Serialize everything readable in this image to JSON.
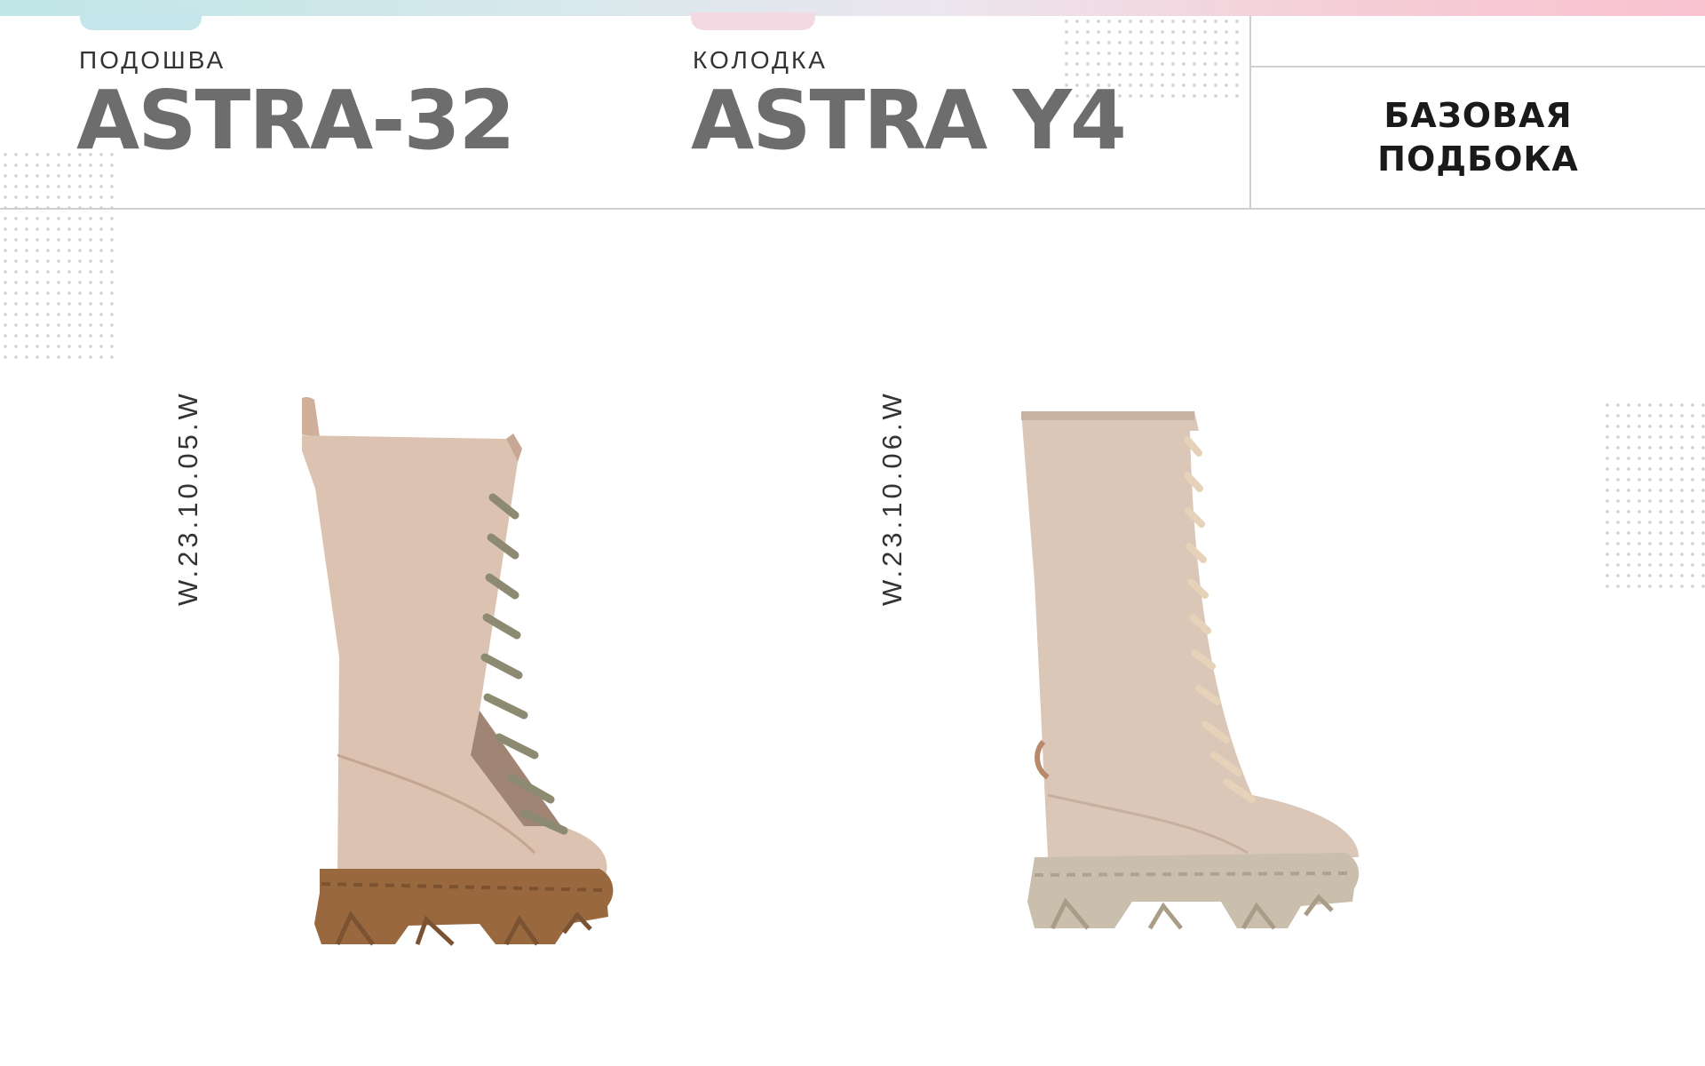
{
  "header": {
    "sole_label": "ПОДОШВА",
    "sole_value": "ASTRA-32",
    "last_label": "КОЛОДКА",
    "last_value": "ASTRA Y4",
    "collection": "БАЗОВАЯ\nПОДБОКА"
  },
  "products": [
    {
      "sku": "W.23.10.05.W",
      "image": "tall-lace-up-boot-beige-suede-brown-sole"
    },
    {
      "sku": "W.23.10.06.W",
      "image": "tall-lace-up-boot-beige-nubuck-grey-sole"
    }
  ],
  "colors": {
    "title_gray": "#6d6d6d",
    "suede_upper": "#dcc3b1",
    "brown_sole": "#99683f",
    "nubuck_upper": "#dbc7b8",
    "gray_sole": "#c9bfac"
  }
}
